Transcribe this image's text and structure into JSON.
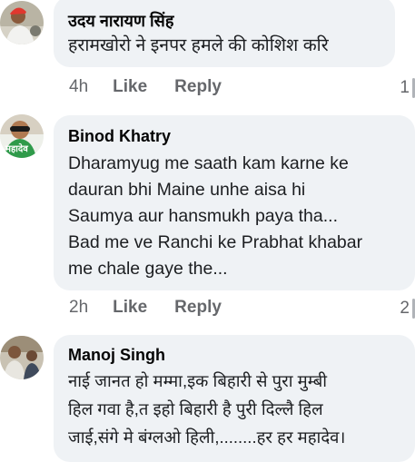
{
  "comments": [
    {
      "author": "उदय नारायण सिंह",
      "text": "हरामखोरो ने इनपर हमले की कोशिश करि",
      "time": "4h",
      "like_label": "Like",
      "reply_label": "Reply",
      "reaction_count": "1"
    },
    {
      "author": "Binod Khatry",
      "avatar_caption": "महादेव",
      "text_lines": [
        "Dharamyug me saath kam karne ke",
        "dauran bhi Maine unhe aisa hi",
        "Saumya aur hansmukh paya tha...",
        "Bad me ve Ranchi ke Prabhat khabar",
        "me chale gaye the..."
      ],
      "time": "2h",
      "like_label": "Like",
      "reply_label": "Reply",
      "reaction_count": "2"
    },
    {
      "author": "Manoj Singh",
      "text_lines": [
        "नाई जानत हो मम्मा,इक बिहारी से पुरा मुम्बी",
        "हिल गवा है,त इहो बिहारी है पुरी दिल्लै हिल",
        "जाई,संगे मे बंग्लओ हिली,........हर हर महादेव।"
      ]
    }
  ],
  "colors": {
    "bubble": "#eff2f5",
    "meta": "#65676b",
    "text": "#050505"
  }
}
